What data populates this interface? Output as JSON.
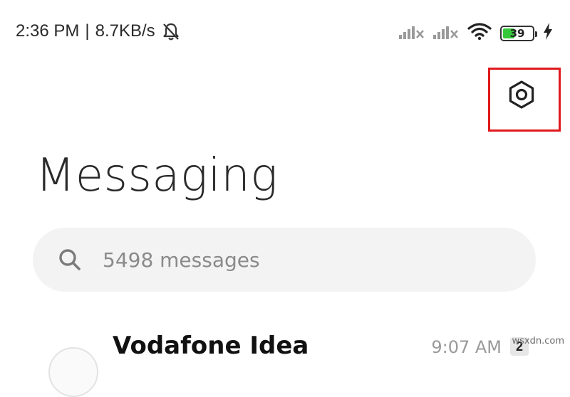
{
  "status_bar": {
    "time": "2:36 PM",
    "separator": "|",
    "speed": "8.7KB/s",
    "icons": [
      "bell-off-icon",
      "signal-no-service-icon",
      "signal-no-service-icon",
      "wifi-icon",
      "battery-icon",
      "charging-bolt-icon"
    ],
    "battery_level": "39",
    "battery_color": "#35c83a"
  },
  "header": {
    "settings_icon": "settings-hexagon-icon",
    "highlight_color": "#e0191d",
    "title": "Messaging"
  },
  "search": {
    "icon": "search-icon",
    "placeholder": "5498 messages"
  },
  "conversations": [
    {
      "sender": "Vodafone Idea",
      "time": "9:07 AM",
      "unread": "2"
    }
  ],
  "watermark": "wsxdn.com"
}
